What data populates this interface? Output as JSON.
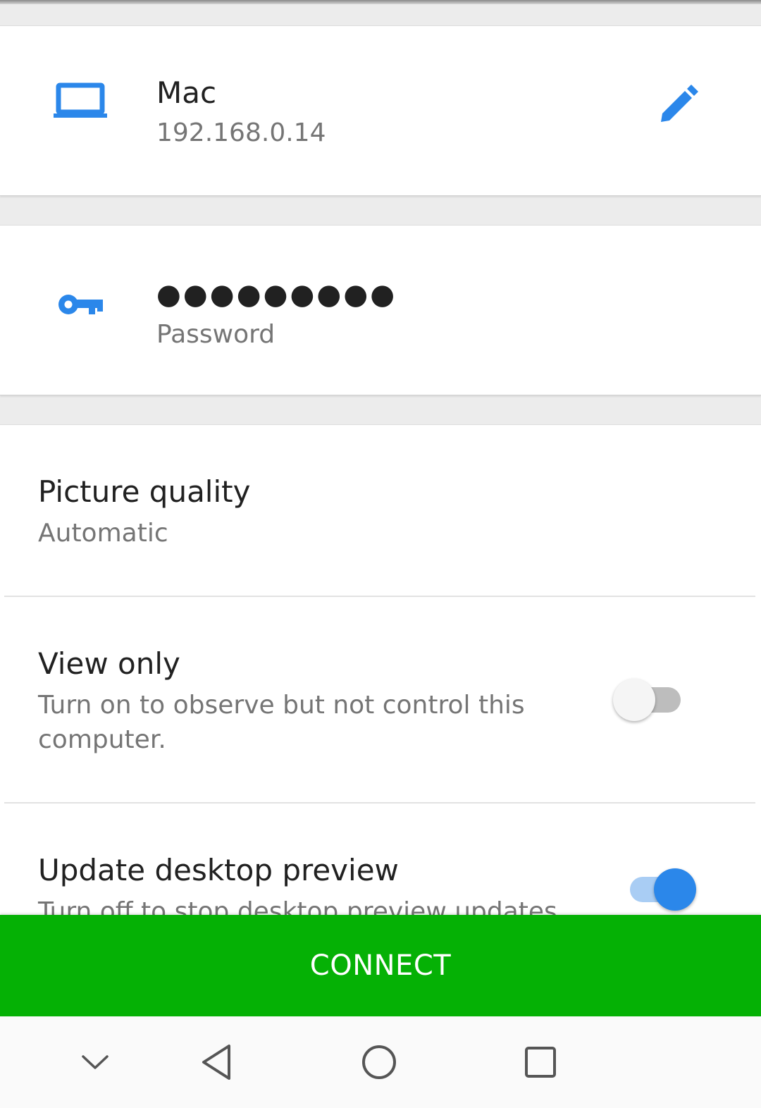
{
  "computer": {
    "name": "Mac",
    "address": "192.168.0.14",
    "device_icon": "laptop-icon",
    "edit_icon": "pencil-edit-icon"
  },
  "password": {
    "masked_value": "●●●●●●●●●",
    "label": "Password",
    "icon": "key-icon"
  },
  "settings": {
    "picture_quality": {
      "title": "Picture quality",
      "value": "Automatic"
    },
    "view_only": {
      "title": "View only",
      "description": "Turn on to observe but not control this computer.",
      "enabled": false
    },
    "update_preview": {
      "title": "Update desktop preview",
      "description": "Turn off to stop desktop preview updates",
      "enabled": true
    }
  },
  "connect_button": {
    "label": "CONNECT"
  },
  "nav_bar": {
    "icons": [
      "chevron-down-icon",
      "back-triangle-icon",
      "home-circle-icon",
      "recents-square-icon"
    ]
  },
  "colors": {
    "accent_blue": "#2b87ea",
    "connect_green": "#05b105",
    "toggle_off_track": "#bdbdbd",
    "toggle_on_track": "#a9cdf4"
  }
}
